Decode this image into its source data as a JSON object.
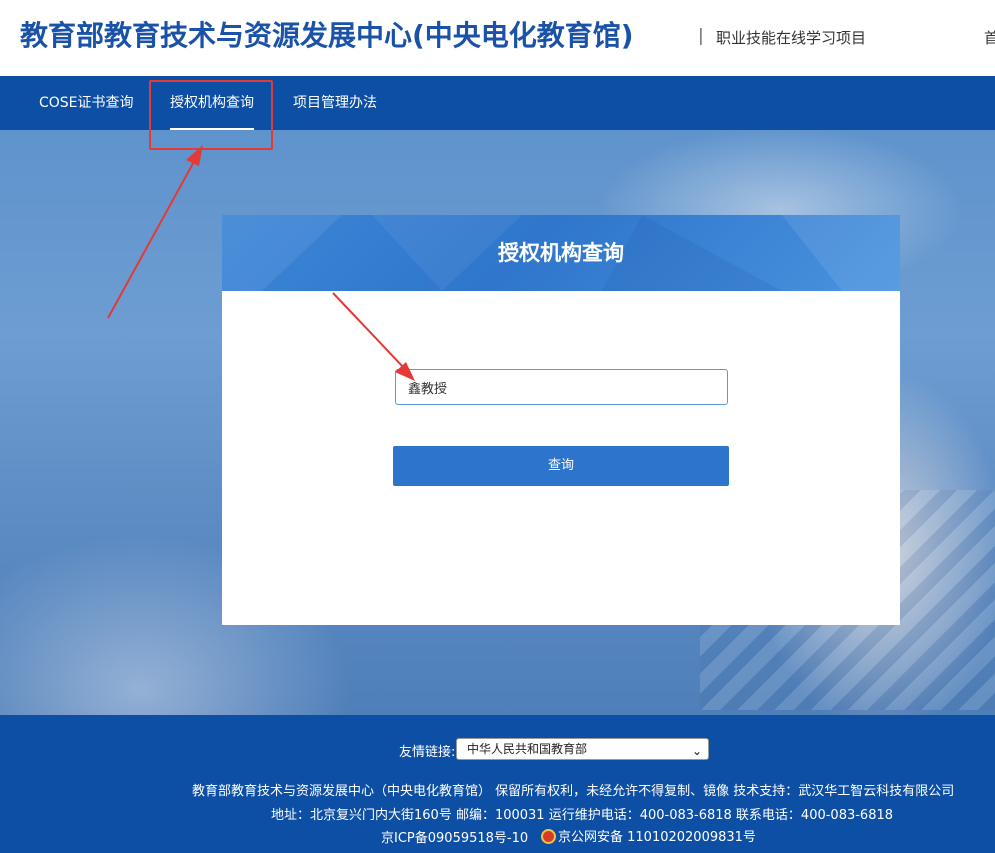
{
  "header": {
    "title": "教育部教育技术与资源发展中心(中央电化教育馆)",
    "separator": "|",
    "subtitle": "职业技能在线学习项目",
    "home_link": "首页"
  },
  "nav": {
    "items": [
      {
        "label": "COSE证书查询"
      },
      {
        "label": "授权机构查询"
      },
      {
        "label": "项目管理办法"
      }
    ],
    "active_index": 1
  },
  "panel": {
    "title": "授权机构查询",
    "search": {
      "value": "鑫教授",
      "placeholder": ""
    },
    "button_label": "查询"
  },
  "footer": {
    "friend_links_label": "友情链接:",
    "friend_links_selected": "中华人民共和国教育部",
    "copyright": "教育部教育技术与资源发展中心（中央电化教育馆） 保留所有权利，未经允许不得复制、镜像 技术支持：武汉华工智云科技有限公司",
    "address": "地址：北京复兴门内大街160号 邮编：100031 运行维护电话：400-083-6818 联系电话：400-083-6818",
    "icp": "京ICP备09059518号-10",
    "police": "京公网安备 11010202009831号"
  },
  "colors": {
    "brand_blue": "#0e4fa6",
    "title_blue": "#1a52a8",
    "button_blue": "#2d74cd",
    "annotation_red": "#e53935"
  },
  "icons": [
    "police-badge-icon",
    "chevron-down-icon"
  ]
}
